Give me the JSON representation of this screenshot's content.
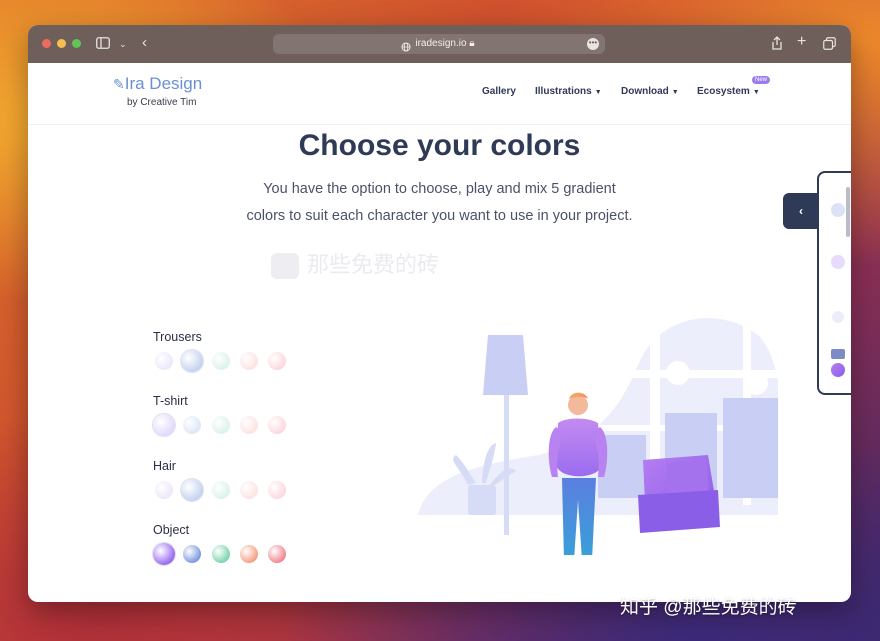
{
  "browser": {
    "url": "iradesign.io",
    "icons": {
      "sidebar": "sidebar-icon",
      "back": "back-icon",
      "share": "share-icon",
      "new_tab": "plus-icon",
      "tabs": "tabs-overview-icon",
      "lock": "lock-icon",
      "more": "more-icon"
    }
  },
  "header": {
    "logo_title": "Ira Design",
    "logo_subtitle": "by Creative Tim",
    "nav": [
      {
        "label": "Gallery"
      },
      {
        "label": "Illustrations"
      },
      {
        "label": "Download"
      },
      {
        "label": "Ecosystem"
      }
    ],
    "new_badge": "New"
  },
  "hero": {
    "title": "Choose your colors",
    "subtitle_line1": "You have the option to choose, play and mix 5 gradient",
    "subtitle_line2": "colors to suit each character you want to use in your project."
  },
  "watermark_text": "那些免费的砖",
  "categories": [
    {
      "label": "Trousers",
      "colors": [
        "#ede7fb",
        "#c6d3ee",
        "#dcf3e9",
        "#fde3e4",
        "#fcd9de"
      ],
      "selected": 1
    },
    {
      "label": "T-shirt",
      "colors": [
        "#e3d9fb",
        "#dde6f7",
        "#dcf3e9",
        "#fde3e4",
        "#fcd9de"
      ],
      "selected": 0
    },
    {
      "label": "Hair",
      "colors": [
        "#ede7fb",
        "#c6d3ee",
        "#dcf3e9",
        "#fde3e4",
        "#fcd9de"
      ],
      "selected": 1
    },
    {
      "label": "Object",
      "colors": [
        "#9a6cf0",
        "#7f9ae0",
        "#7fd6ae",
        "#f5a184",
        "#f08890"
      ],
      "selected": 0
    }
  ],
  "side_panel": {
    "toggle_icon": "chevron-left-icon"
  },
  "corner_watermark": "知乎 @那些免费的砖",
  "colors": {
    "accent": "#2f3a57",
    "brand": "#6b8fd6",
    "badge": "#9b7cf0"
  }
}
